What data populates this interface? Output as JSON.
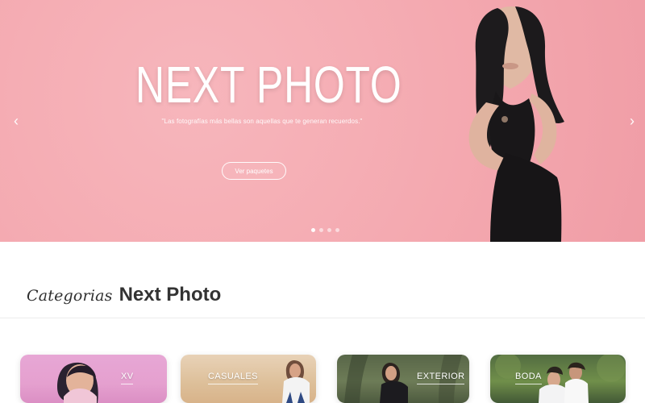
{
  "hero": {
    "title": "NEXT PHOTO",
    "quote": "\"Las fotografías más bellas son aquellas que te generan recuerdos.\"",
    "cta_label": "Ver paquetes",
    "colors": {
      "background": "#f4a9b0",
      "text": "#ffffff"
    },
    "slides": {
      "count": 4,
      "active_index": 0
    }
  },
  "categories": {
    "script_label": "Categorias",
    "bold_label": "Next Photo",
    "items": [
      {
        "label": "XV"
      },
      {
        "label": "CASUALES"
      },
      {
        "label": "EXTERIOR"
      },
      {
        "label": "BODA"
      }
    ]
  },
  "icons": {
    "left": "chevron-left-icon",
    "right": "chevron-right-icon"
  }
}
